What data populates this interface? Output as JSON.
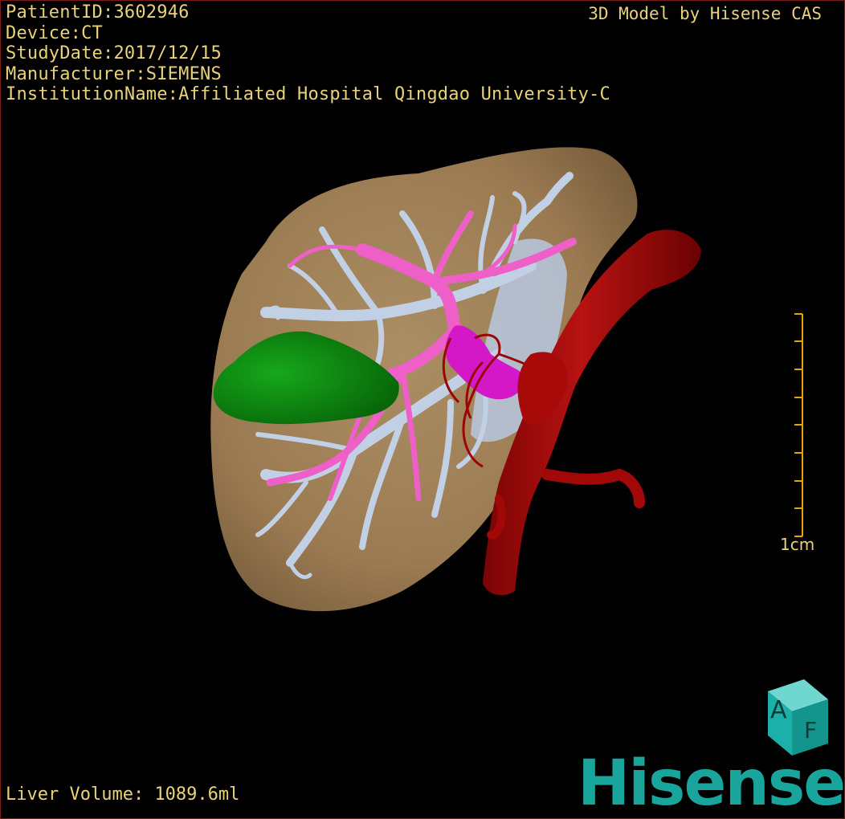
{
  "overlay": {
    "info_lines": [
      "PatientID:3602946",
      "Device:CT",
      "StudyDate:2017/12/15",
      "Manufacturer:SIEMENS",
      "InstitutionName:Affiliated Hospital Qingdao University-C"
    ],
    "brand_caption": "3D Model by Hisense CAS",
    "liver_volume": "Liver Volume: 1089.6ml",
    "scale_label": "1cm"
  },
  "logo": {
    "cube_letters": [
      "A",
      "F"
    ],
    "brand_name": "Hisense"
  },
  "model": {
    "structures": [
      "liver-surface",
      "portal-vein",
      "hepatic-artery",
      "hepatic-veins",
      "tumor",
      "inferior-vena-cava"
    ]
  },
  "colors": {
    "text": "#e8d27a",
    "liver": "#a4855a",
    "hepatic_veins": "#c2d0e6",
    "portal_vein": "#ee5fc8",
    "tumor": "#0d8a10",
    "vena_cava": "#a30808",
    "brand": "#19a59c"
  }
}
